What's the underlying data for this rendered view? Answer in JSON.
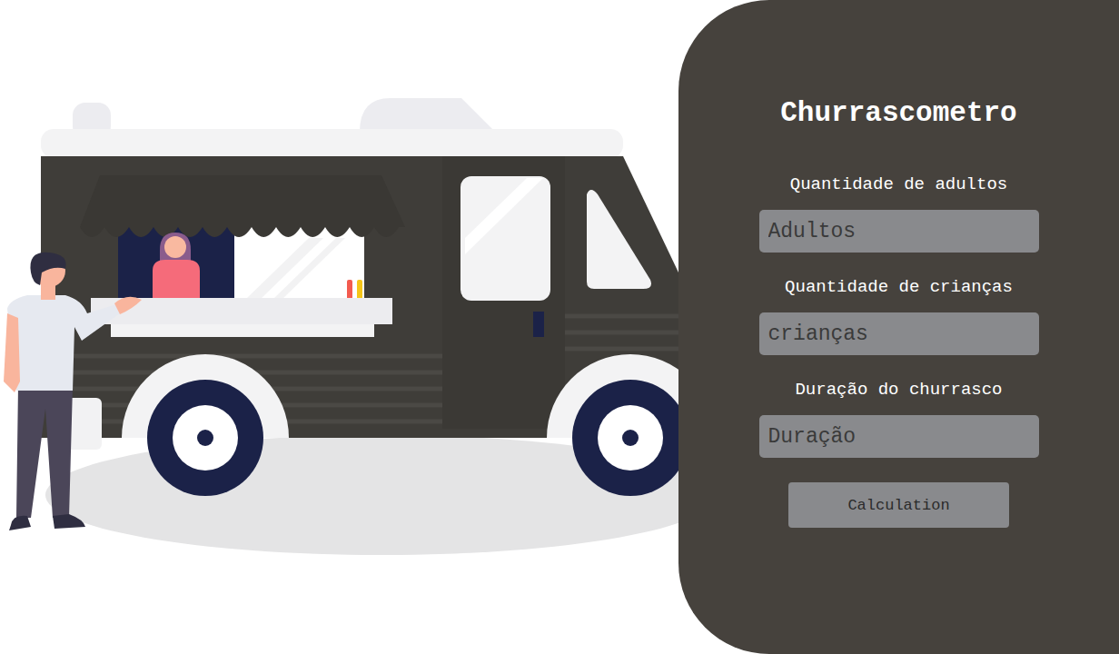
{
  "title": "Churrascometro",
  "fields": [
    {
      "label": "Quantidade de adultos",
      "placeholder": "Adultos"
    },
    {
      "label": "Quantidade de crianças",
      "placeholder": "crianças"
    },
    {
      "label": "Duração do churrasco",
      "placeholder": "Duração"
    }
  ],
  "button": "Calculation"
}
